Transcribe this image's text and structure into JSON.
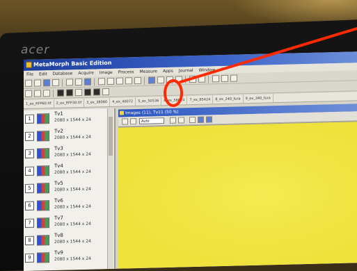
{
  "monitor": {
    "brand": "acer"
  },
  "app": {
    "title": "MetaMorph Basic Edition"
  },
  "menu": [
    "File",
    "Edit",
    "Database",
    "Acquire",
    "Image",
    "Process",
    "Measure",
    "Apps",
    "Journal",
    "Window",
    "?"
  ],
  "tabs": [
    "1_ex_RFP60.tif",
    "2_ex_RFP30.tif",
    "3_ex_38080",
    "4_ex_40072",
    "5_ex_50536",
    "6_ex_56024",
    "7_ex_65424",
    "8_ex_240_fura",
    "9_ex_340_fura"
  ],
  "thumbnails": [
    {
      "num": "1",
      "name": "Tv1",
      "size": "2080 x 1544 x 24"
    },
    {
      "num": "2",
      "name": "Tv2",
      "size": "2080 x 1544 x 24"
    },
    {
      "num": "3",
      "name": "Tv3",
      "size": "2080 x 1544 x 24"
    },
    {
      "num": "4",
      "name": "Tv4",
      "size": "2080 x 1544 x 24"
    },
    {
      "num": "5",
      "name": "Tv5",
      "size": "2080 x 1544 x 24"
    },
    {
      "num": "6",
      "name": "Tv6",
      "size": "2080 x 1544 x 24"
    },
    {
      "num": "7",
      "name": "Tv7",
      "size": "2080 x 1544 x 24"
    },
    {
      "num": "8",
      "name": "Tv8",
      "size": "2080 x 1544 x 24"
    },
    {
      "num": "9",
      "name": "Tv9",
      "size": "2080 x 1544 x 24"
    }
  ],
  "image_window": {
    "title": "Images (11), Tv11 (50 %)",
    "zoom": "Auto"
  },
  "annotation_color": "#ff2a00"
}
